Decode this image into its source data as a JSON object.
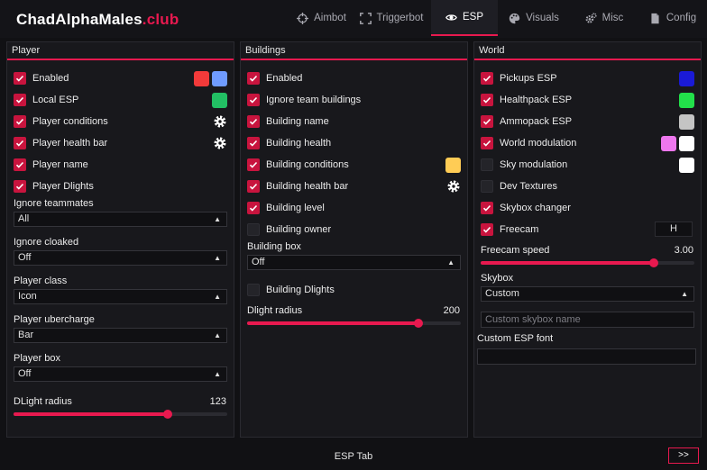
{
  "brand": {
    "name": "ChadAlphaMales",
    "suffix": ".club"
  },
  "tabs": [
    "Aimbot",
    "Triggerbot",
    "ESP",
    "Visuals",
    "Misc",
    "Config"
  ],
  "active_tab": "ESP",
  "colors": {
    "accent": "#e8194f",
    "checkbox_on": "#c8143e"
  },
  "player": {
    "title": "Player",
    "checks": [
      {
        "label": "Enabled",
        "checked": true,
        "swatches": [
          "#f23a3a",
          "#6f9bff"
        ]
      },
      {
        "label": "Local ESP",
        "checked": true,
        "swatches": [
          "#22c064"
        ]
      },
      {
        "label": "Player conditions",
        "checked": true,
        "gear": true
      },
      {
        "label": "Player health bar",
        "checked": true,
        "gear": true
      },
      {
        "label": "Player name",
        "checked": true
      },
      {
        "label": "Player Dlights",
        "checked": true
      }
    ],
    "selects": [
      {
        "label": "Ignore teammates",
        "value": "All"
      },
      {
        "label": "Ignore cloaked",
        "value": "Off"
      },
      {
        "label": "Player class",
        "value": "Icon"
      },
      {
        "label": "Player ubercharge",
        "value": "Bar"
      },
      {
        "label": "Player box",
        "value": "Off"
      }
    ],
    "slider": {
      "label": "DLight radius",
      "value": "123",
      "fraction": 0.72
    }
  },
  "buildings": {
    "title": "Buildings",
    "checks": [
      {
        "label": "Enabled",
        "checked": true
      },
      {
        "label": "Ignore team buildings",
        "checked": true
      },
      {
        "label": "Building name",
        "checked": true
      },
      {
        "label": "Building health",
        "checked": true
      },
      {
        "label": "Building conditions",
        "checked": true,
        "swatches": [
          "#ffcc55"
        ]
      },
      {
        "label": "Building health bar",
        "checked": true,
        "gear": true
      },
      {
        "label": "Building level",
        "checked": true
      },
      {
        "label": "Building owner",
        "checked": false
      }
    ],
    "box": {
      "label": "Building box",
      "value": "Off"
    },
    "dlights": {
      "label": "Building Dlights",
      "checked": false
    },
    "slider": {
      "label": "Dlight radius",
      "value": "200",
      "fraction": 0.8
    }
  },
  "world": {
    "title": "World",
    "checks": [
      {
        "label": "Pickups ESP",
        "checked": true,
        "swatches": [
          "#1a1ad6"
        ]
      },
      {
        "label": "Healthpack ESP",
        "checked": true,
        "swatches": [
          "#22e04a"
        ]
      },
      {
        "label": "Ammopack ESP",
        "checked": true,
        "swatches": [
          "#c4c4c4"
        ]
      },
      {
        "label": "World modulation",
        "checked": true,
        "swatches": [
          "#ee77ee",
          "#ffffff"
        ]
      },
      {
        "label": "Sky modulation",
        "checked": false,
        "swatches": [
          "#ffffff"
        ]
      },
      {
        "label": "Dev Textures",
        "checked": false
      },
      {
        "label": "Skybox changer",
        "checked": true
      },
      {
        "label": "Freecam",
        "checked": true,
        "key": "H"
      }
    ],
    "slider": {
      "label": "Freecam speed",
      "value": "3.00",
      "fraction": 0.81
    },
    "skybox": {
      "label": "Skybox",
      "value": "Custom"
    },
    "skybox_name_placeholder": "Custom skybox name",
    "font": {
      "label": "Custom ESP font",
      "value": ""
    }
  },
  "footer": {
    "label": "ESP Tab",
    "next": ">>"
  }
}
